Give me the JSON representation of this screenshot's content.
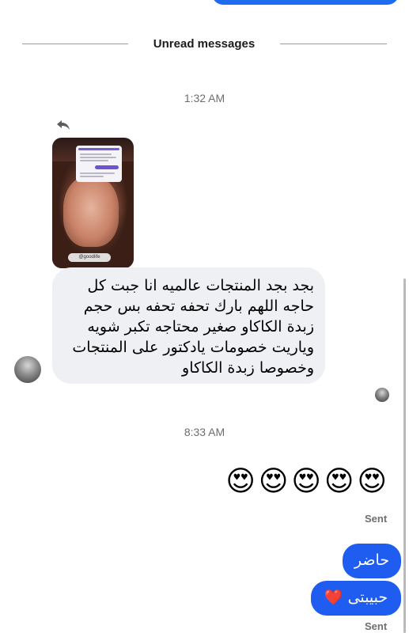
{
  "divider": {
    "label": "Unread messages"
  },
  "timestamps": [
    "1:32 AM",
    "8:33 AM"
  ],
  "story_reply": {
    "reply_icon": "reply-arrow-icon",
    "story_tag": "@goodlife"
  },
  "incoming_message": {
    "text": "بجد بجد المنتجات عالميه انا جبت كل حاجه اللهم بارك تحفه تحفه بس حجم زبدة الكاكاو صغير محتاجه تكبر شويه وياريت خصومات يادكتور على المنتجات وخصوصا زبدة الكاكاو"
  },
  "emoji_message": {
    "text": "😍😍😍😍😍"
  },
  "outgoing_messages": [
    {
      "text": "حاضر"
    },
    {
      "text": "حبيبتى ❤️"
    }
  ],
  "status": {
    "sent_1": "Sent",
    "sent_2": "Sent"
  },
  "colors": {
    "outgoing_bubble": "#1f5cf0",
    "incoming_bubble": "#eff0f4",
    "timestamp": "#6e6e6e"
  }
}
